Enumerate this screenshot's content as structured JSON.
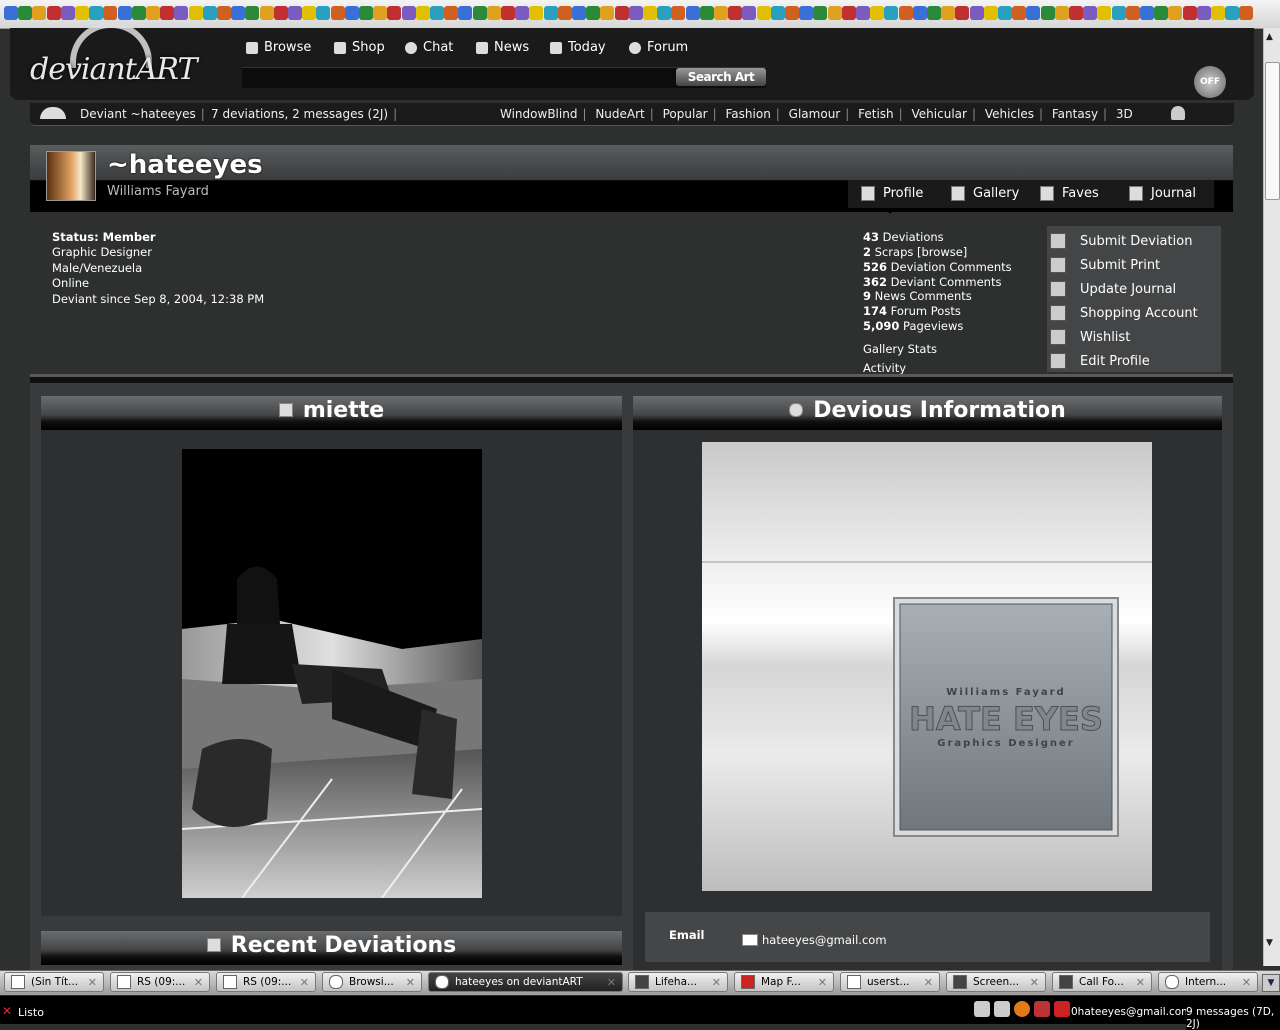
{
  "browser": {
    "status": "Listo",
    "tray_email": "0hateeyes@gmail.com",
    "tray_messages": "9 messages (7D, 2J)"
  },
  "nav": {
    "logo": "deviantART",
    "items": [
      "Browse",
      "Shop",
      "Chat",
      "News",
      "Today",
      "Forum"
    ],
    "search_button": "Search Art",
    "off_button": "OFF"
  },
  "userbar": {
    "deviant": "Deviant ~hateeyes",
    "summary": "7 deviations, 2 messages (2J)",
    "categories": [
      "WindowBlind",
      "NudeArt",
      "Popular",
      "Fashion",
      "Glamour",
      "Fetish",
      "Vehicular",
      "Vehicles",
      "Fantasy",
      "3D"
    ]
  },
  "profile": {
    "username": "~hateeyes",
    "realname": "Williams Fayard",
    "tabs": [
      "Profile",
      "Gallery",
      "Faves",
      "Journal"
    ],
    "status": "Status: Member",
    "info": [
      "Graphic Designer",
      "Male/Venezuela",
      "Online",
      "Deviant since Sep 8, 2004, 12:38 PM"
    ],
    "stats": [
      {
        "num": "43",
        "label": "Deviations"
      },
      {
        "num": "2",
        "label": "Scraps [browse]"
      },
      {
        "num": "526",
        "label": "Deviation Comments"
      },
      {
        "num": "362",
        "label": "Deviant Comments"
      },
      {
        "num": "9",
        "label": "News Comments"
      },
      {
        "num": "174",
        "label": "Forum Posts"
      },
      {
        "num": "5,090",
        "label": "Pageviews"
      }
    ],
    "links": [
      "Gallery Stats",
      "Activity"
    ],
    "actions": [
      "Submit Deviation",
      "Submit Print",
      "Update Journal",
      "Shopping Account",
      "Wishlist",
      "Edit Profile"
    ]
  },
  "boxes": {
    "featured_title": "miette",
    "devious_title": "Devious Information",
    "recent_title": "Recent Deviations",
    "id_card": {
      "name": "Williams Fayard",
      "alias": "HATE EYES",
      "role": "Graphics Designer"
    },
    "email_label": "Email",
    "email_value": "hateeyes@gmail.com"
  },
  "taskbar": [
    {
      "label": "(Sin Tít...",
      "active": false
    },
    {
      "label": "RS (09:...",
      "active": false
    },
    {
      "label": "RS (09:...",
      "active": false
    },
    {
      "label": "Browsi...",
      "active": false
    },
    {
      "label": "hateeyes on deviantART",
      "active": true
    },
    {
      "label": "Lifeha...",
      "active": false
    },
    {
      "label": "Map F...",
      "active": false
    },
    {
      "label": "userst...",
      "active": false
    },
    {
      "label": "Screen...",
      "active": false
    },
    {
      "label": "Call Fo...",
      "active": false
    },
    {
      "label": "Intern...",
      "active": false
    }
  ],
  "colors": {
    "page_bg": "#2e2f2f",
    "panel_bg": "#444546",
    "header_bg": "#1a1a1a"
  }
}
